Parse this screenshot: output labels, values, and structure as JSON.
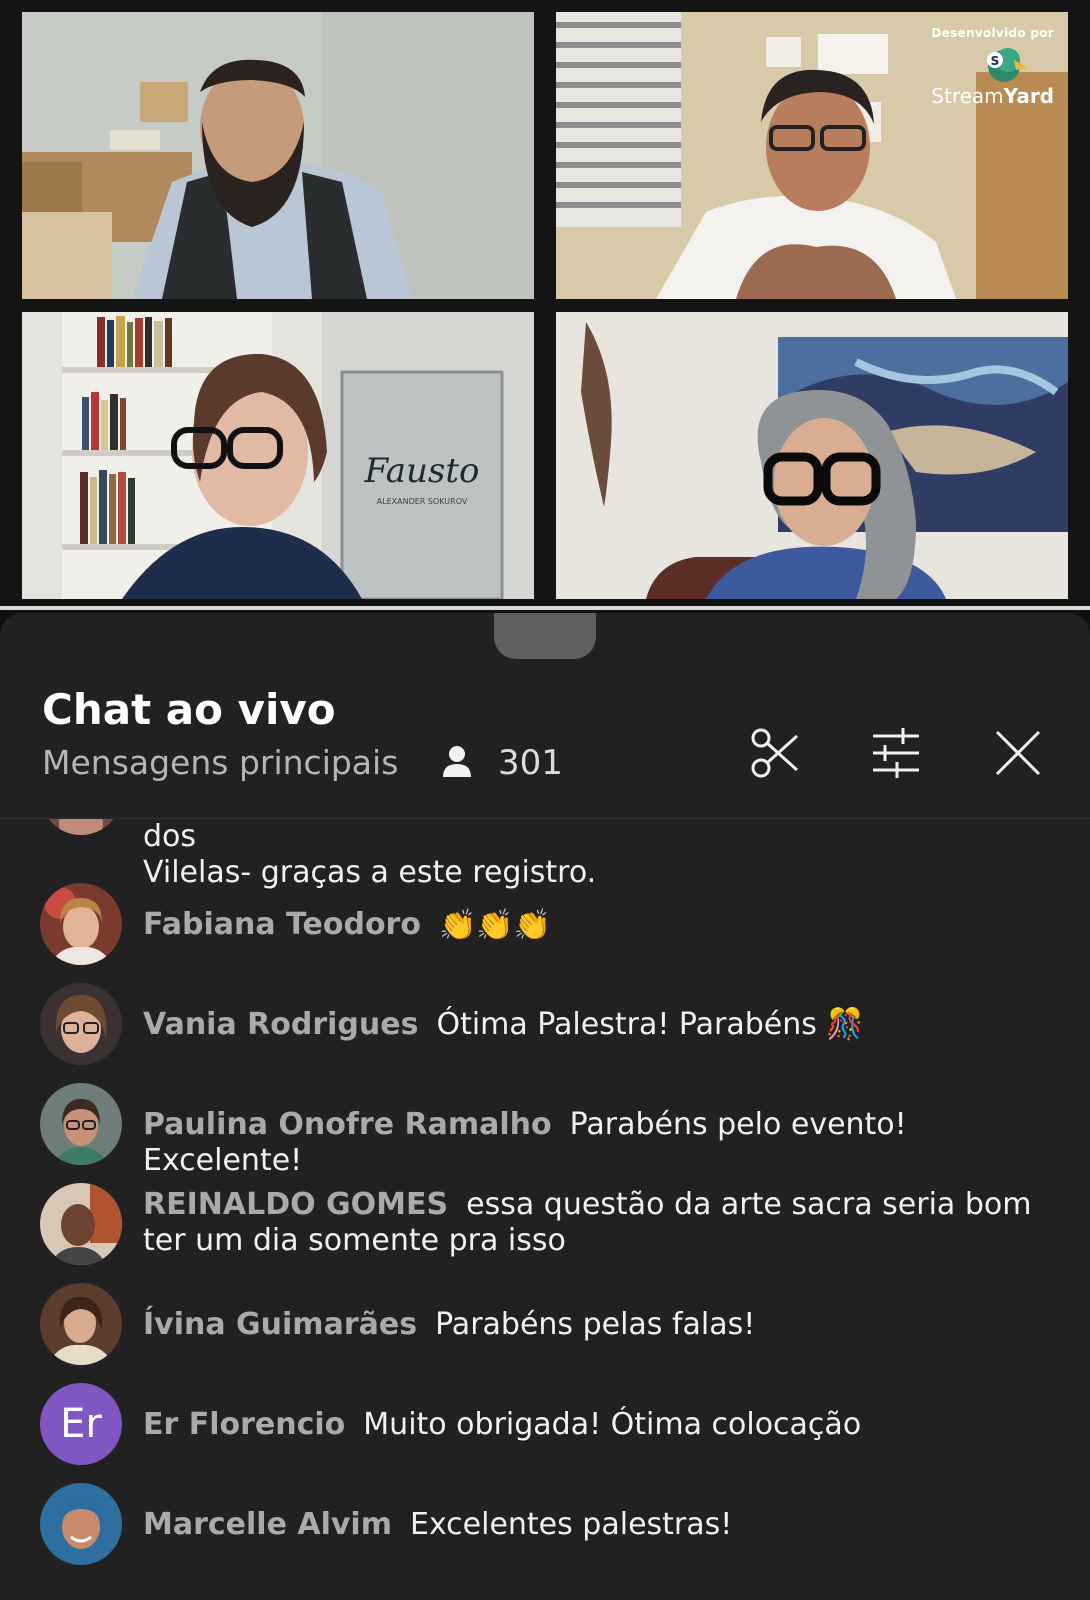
{
  "branding": {
    "developed_by": "Desenvolvido por",
    "brand_light": "Stream",
    "brand_bold": "Yard"
  },
  "video": {
    "tile3_poster_title": "Fausto",
    "tile3_poster_sub": "ALEXANDER SOKUROV"
  },
  "chat": {
    "title": "Chat ao vivo",
    "subtitle": "Mensagens principais",
    "viewer_count": "301",
    "icons": {
      "clip": "scissors-icon",
      "filter": "sliders-icon",
      "close": "close-icon"
    },
    "messages": [
      {
        "author": "",
        "text": "imagem de Nossa Senhora do Rosário de Itaguara - Pará dos",
        "text2": "Vilelas- graças a este registro."
      },
      {
        "author": "Fabiana Teodoro",
        "text": "👏👏👏"
      },
      {
        "author": "Vania Rodrigues",
        "text": "Ótima Palestra! Parabéns 🎊"
      },
      {
        "author": "Paulina Onofre Ramalho",
        "text": "Parabéns pelo evento! Excelente!"
      },
      {
        "author": "REINALDO GOMES",
        "text": "essa questão da arte sacra seria bom",
        "text2": "ter um dia somente pra isso"
      },
      {
        "author": "Ívina Guimarães",
        "text": "Parabéns pelas falas!"
      },
      {
        "author": "Er Florencio",
        "text": "Muito obrigada! Ótima colocação",
        "avatar_letters": "Er"
      },
      {
        "author": "Marcelle Alvim",
        "text": "Excelentes palestras!"
      }
    ]
  }
}
